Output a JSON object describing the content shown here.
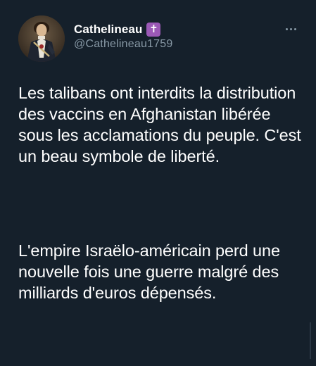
{
  "tweet": {
    "author": {
      "display_name": "Cathelineau",
      "handle": "@Cathelineau1759",
      "badge": "✝"
    },
    "paragraphs": [
      "Les talibans ont interdits la distribution des vaccins en Afghanistan libérée sous les acclamations du peuple. C'est un beau symbole de liberté.",
      "L'empire Israëlo-américain perd une nouvelle fois une guerre malgré des milliards d'euros dépensés."
    ]
  },
  "colors": {
    "background": "#15202b",
    "text": "#ffffff",
    "secondary_text": "#8899a6",
    "badge": "#9b59b6"
  },
  "icons": {
    "more": "more-horizontal-icon",
    "badge": "cross-emoji-icon"
  }
}
